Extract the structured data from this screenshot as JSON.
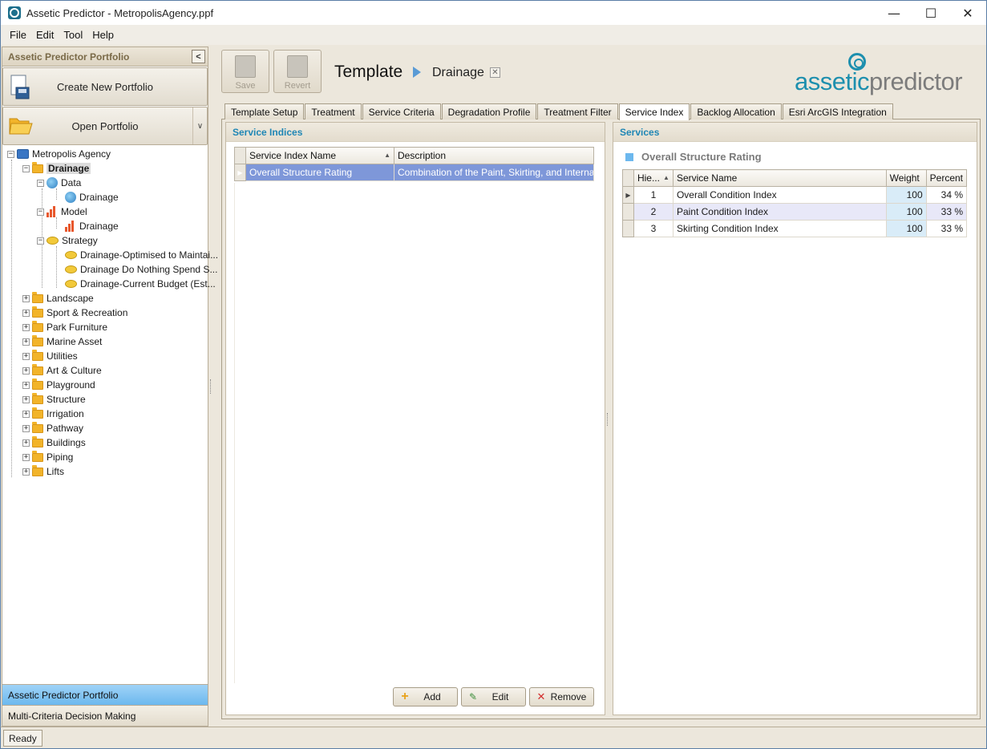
{
  "window": {
    "title": "Assetic Predictor - MetropolisAgency.ppf",
    "minimize": "—",
    "maximize": "☐",
    "close": "✕"
  },
  "menu": [
    "File",
    "Edit",
    "Tool",
    "Help"
  ],
  "left_pane": {
    "header": "Assetic Predictor Portfolio",
    "create_button": "Create New Portfolio",
    "open_button": "Open Portfolio",
    "tree": {
      "root": "Metropolis Agency",
      "selected": "Drainage",
      "data_node": "Data",
      "data_child": "Drainage",
      "model_node": "Model",
      "model_child": "Drainage",
      "strategy_node": "Strategy",
      "strategies": [
        "Drainage-Optimised to Maintai...",
        "Drainage Do Nothing Spend S...",
        "Drainage-Current Budget (Est..."
      ],
      "categories": [
        "Landscape",
        "Sport & Recreation",
        "Park Furniture",
        "Marine Asset",
        "Utilities",
        "Art & Culture",
        "Playground",
        "Structure",
        "Irrigation",
        "Pathway",
        "Buildings",
        "Piping",
        "Lifts"
      ]
    },
    "nav": {
      "active": "Assetic Predictor Portfolio",
      "inactive": "Multi-Criteria Decision Making"
    }
  },
  "toolbar": {
    "save_label": "Save",
    "revert_label": "Revert",
    "title": "Template",
    "subtitle": "Drainage",
    "close_glyph": "✕"
  },
  "logo": {
    "part1": "assetic",
    "part2": "predictor"
  },
  "tabs": [
    "Template Setup",
    "Treatment",
    "Service Criteria",
    "Degradation Profile",
    "Treatment Filter",
    "Service Index",
    "Backlog Allocation",
    "Esri ArcGIS Integration"
  ],
  "active_tab": "Service Index",
  "service_indices": {
    "title": "Service Indices",
    "columns": [
      "Service Index Name",
      "Description"
    ],
    "rows": [
      {
        "name": "Overall Structure Rating",
        "description": "Combination of the Paint, Skirting, and Internal ..."
      }
    ],
    "buttons": {
      "add": "Add",
      "edit": "Edit",
      "remove": "Remove"
    }
  },
  "services": {
    "title": "Services",
    "subtitle": "Overall Structure Rating",
    "columns": [
      "Hie...",
      "Service Name",
      "Weight",
      "Percent"
    ],
    "rows": [
      {
        "hierarchy": "1",
        "name": "Overall Condition Index",
        "weight": "100",
        "percent": "34 %"
      },
      {
        "hierarchy": "2",
        "name": "Paint Condition Index",
        "weight": "100",
        "percent": "33 %"
      },
      {
        "hierarchy": "3",
        "name": "Skirting Condition Index",
        "weight": "100",
        "percent": "33 %"
      }
    ]
  },
  "status": "Ready",
  "colors": {
    "accent": "#1f86b5",
    "selection": "#7e97d9",
    "nav_active": "#6cb8ee"
  }
}
